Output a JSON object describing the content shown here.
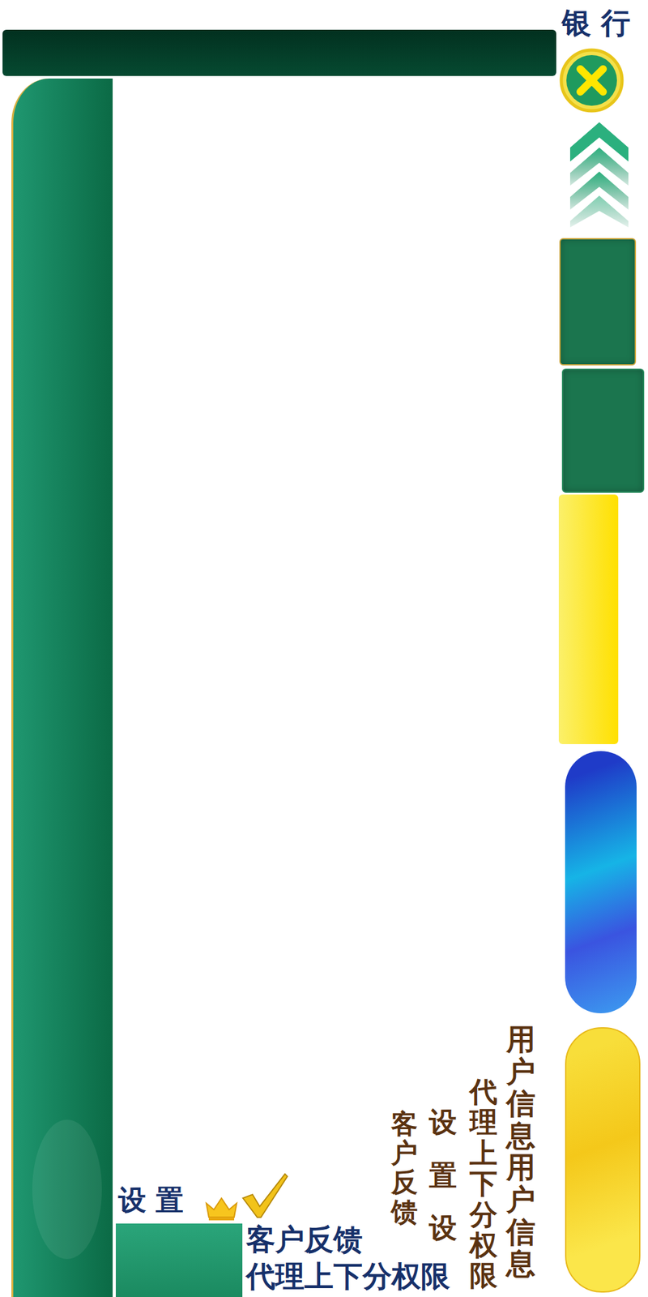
{
  "header": {
    "title": "银 行"
  },
  "settings": {
    "label": "设 置"
  },
  "labels": [
    "客户反馈",
    "代理上下分权限"
  ],
  "vertical_labels": [
    "用户信息用户信息",
    "代理上下分权限",
    "设置设",
    "客户反馈"
  ]
}
